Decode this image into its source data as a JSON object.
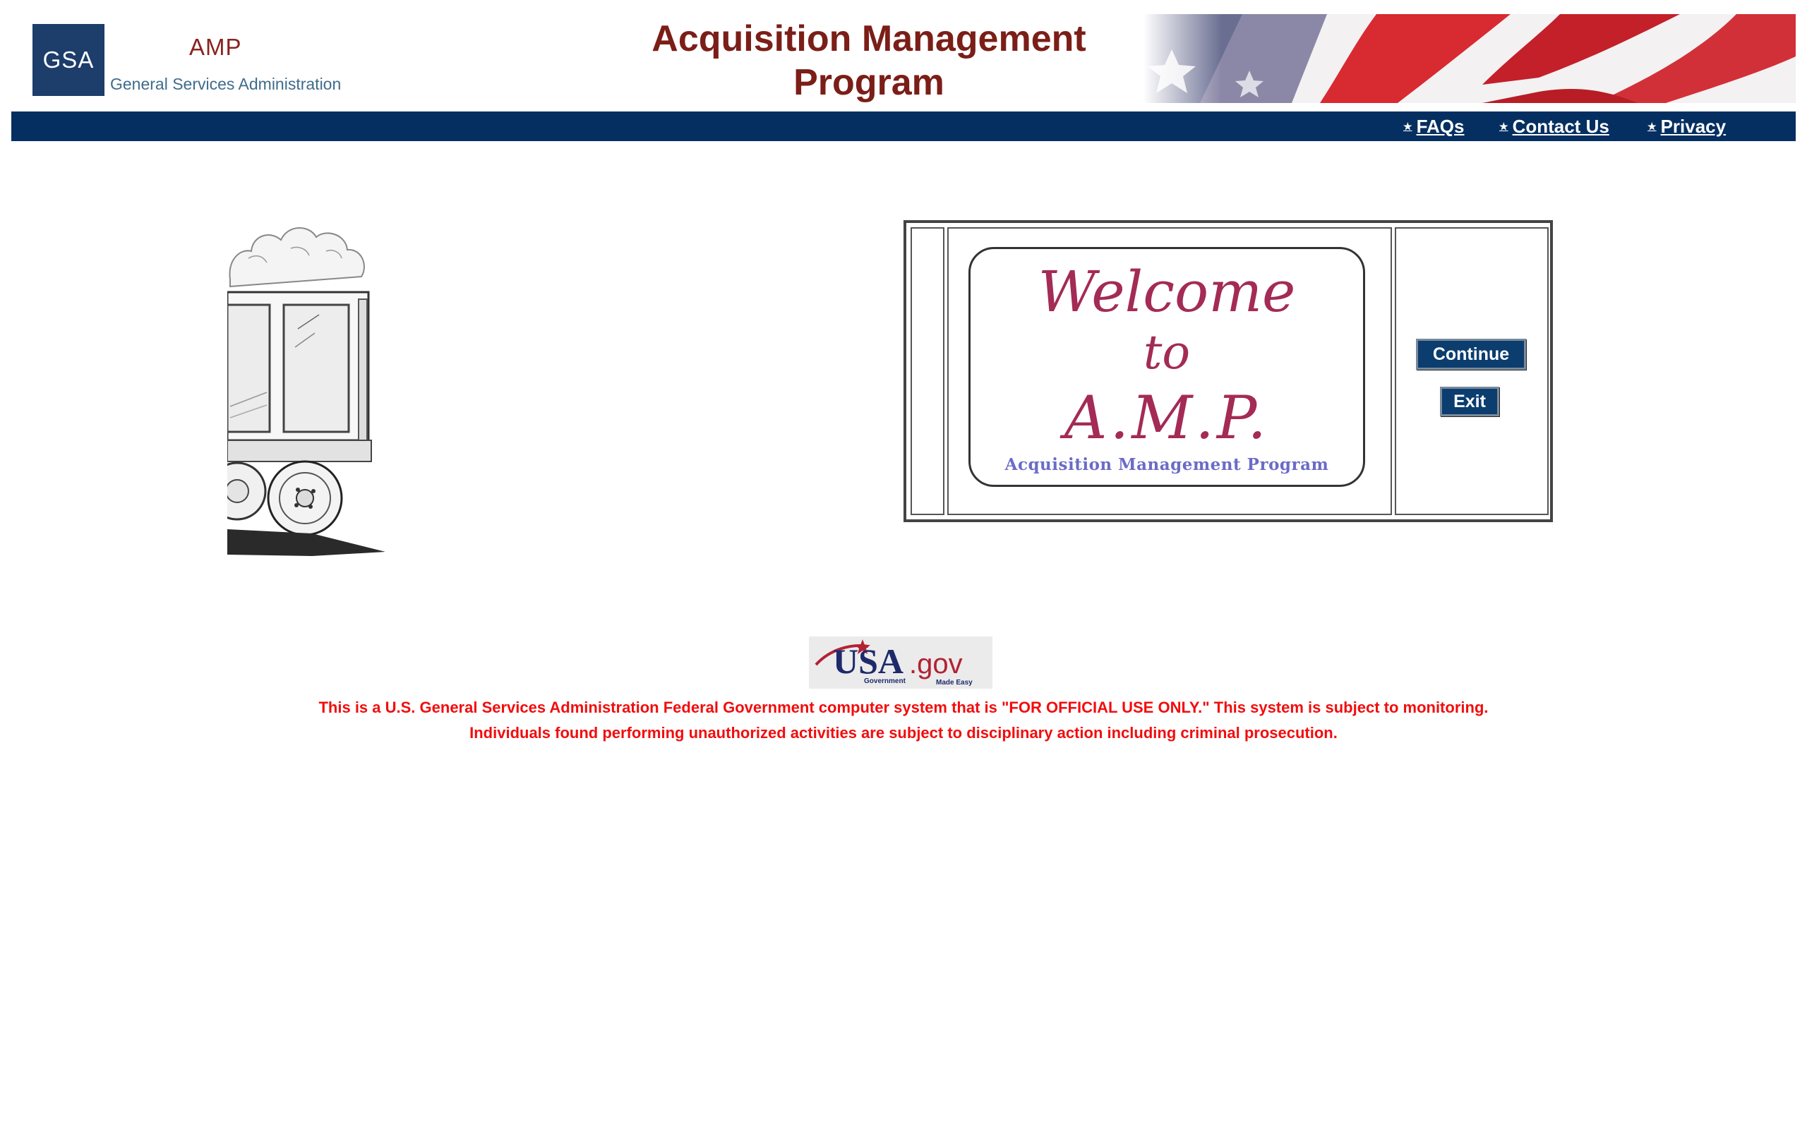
{
  "header": {
    "logo_mark": "GSA",
    "logo_app": "AMP",
    "logo_org": "General Services Administration",
    "title_line1": "Acquisition Management",
    "title_line2": "Program"
  },
  "nav": {
    "items": [
      {
        "label": "FAQs",
        "icon": "star-icon"
      },
      {
        "label": "Contact Us",
        "icon": "star-icon"
      },
      {
        "label": "Privacy",
        "icon": "star-icon"
      }
    ]
  },
  "welcome": {
    "line1": "Welcome",
    "line2": "to",
    "line3": "A.M.P.",
    "subtitle": "Acquisition Management Program"
  },
  "buttons": {
    "continue": "Continue",
    "exit": "Exit"
  },
  "footer": {
    "usagov_main": "USA",
    "usagov_tld": ".gov",
    "usagov_tag1": "Government",
    "usagov_tag2": "Made Easy",
    "warning_line1": "This is a U.S. General Services Administration Federal Government computer system that is \"FOR OFFICIAL USE ONLY.\" This system is subject to monitoring.",
    "warning_line2": "Individuals found performing unauthorized activities are subject to disciplinary action including criminal prosecution."
  },
  "colors": {
    "navbar": "#062f61",
    "title": "#7b1e18",
    "warning": "#f20d0d",
    "button": "#0b3d6e",
    "script": "#a32b55"
  }
}
